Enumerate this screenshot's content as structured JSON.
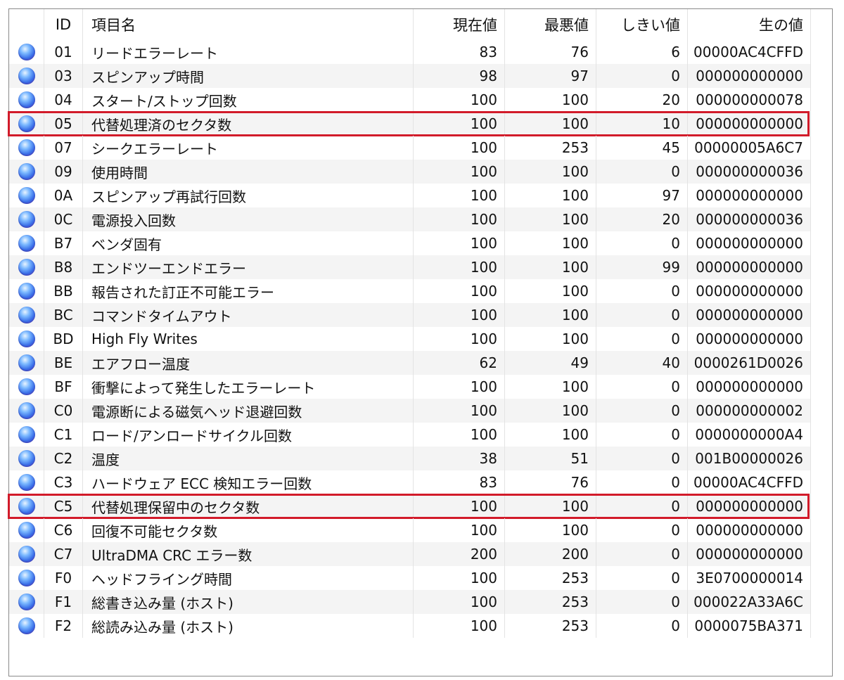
{
  "columns": {
    "id": "ID",
    "name": "項目名",
    "current": "現在値",
    "worst": "最悪値",
    "threshold": "しきい値",
    "raw": "生の値"
  },
  "status_icon": "health-good-icon",
  "highlight_color": "#d21b2a",
  "rows": [
    {
      "id": "01",
      "name": "リードエラーレート",
      "current": "83",
      "worst": "76",
      "threshold": "6",
      "raw": "00000AC4CFFD",
      "highlighted": false
    },
    {
      "id": "03",
      "name": "スピンアップ時間",
      "current": "98",
      "worst": "97",
      "threshold": "0",
      "raw": "000000000000",
      "highlighted": false
    },
    {
      "id": "04",
      "name": "スタート/ストップ回数",
      "current": "100",
      "worst": "100",
      "threshold": "20",
      "raw": "000000000078",
      "highlighted": false
    },
    {
      "id": "05",
      "name": "代替処理済のセクタ数",
      "current": "100",
      "worst": "100",
      "threshold": "10",
      "raw": "000000000000",
      "highlighted": true
    },
    {
      "id": "07",
      "name": "シークエラーレート",
      "current": "100",
      "worst": "253",
      "threshold": "45",
      "raw": "00000005A6C7",
      "highlighted": false
    },
    {
      "id": "09",
      "name": "使用時間",
      "current": "100",
      "worst": "100",
      "threshold": "0",
      "raw": "000000000036",
      "highlighted": false
    },
    {
      "id": "0A",
      "name": "スピンアップ再試行回数",
      "current": "100",
      "worst": "100",
      "threshold": "97",
      "raw": "000000000000",
      "highlighted": false
    },
    {
      "id": "0C",
      "name": "電源投入回数",
      "current": "100",
      "worst": "100",
      "threshold": "20",
      "raw": "000000000036",
      "highlighted": false
    },
    {
      "id": "B7",
      "name": "ベンダ固有",
      "current": "100",
      "worst": "100",
      "threshold": "0",
      "raw": "000000000000",
      "highlighted": false
    },
    {
      "id": "B8",
      "name": "エンドツーエンドエラー",
      "current": "100",
      "worst": "100",
      "threshold": "99",
      "raw": "000000000000",
      "highlighted": false
    },
    {
      "id": "BB",
      "name": "報告された訂正不可能エラー",
      "current": "100",
      "worst": "100",
      "threshold": "0",
      "raw": "000000000000",
      "highlighted": false
    },
    {
      "id": "BC",
      "name": "コマンドタイムアウト",
      "current": "100",
      "worst": "100",
      "threshold": "0",
      "raw": "000000000000",
      "highlighted": false
    },
    {
      "id": "BD",
      "name": "High Fly Writes",
      "current": "100",
      "worst": "100",
      "threshold": "0",
      "raw": "000000000000",
      "highlighted": false
    },
    {
      "id": "BE",
      "name": "エアフロー温度",
      "current": "62",
      "worst": "49",
      "threshold": "40",
      "raw": "0000261D0026",
      "highlighted": false
    },
    {
      "id": "BF",
      "name": "衝撃によって発生したエラーレート",
      "current": "100",
      "worst": "100",
      "threshold": "0",
      "raw": "000000000000",
      "highlighted": false
    },
    {
      "id": "C0",
      "name": "電源断による磁気ヘッド退避回数",
      "current": "100",
      "worst": "100",
      "threshold": "0",
      "raw": "000000000002",
      "highlighted": false
    },
    {
      "id": "C1",
      "name": "ロード/アンロードサイクル回数",
      "current": "100",
      "worst": "100",
      "threshold": "0",
      "raw": "0000000000A4",
      "highlighted": false
    },
    {
      "id": "C2",
      "name": "温度",
      "current": "38",
      "worst": "51",
      "threshold": "0",
      "raw": "001B00000026",
      "highlighted": false
    },
    {
      "id": "C3",
      "name": "ハードウェア ECC 検知エラー回数",
      "current": "83",
      "worst": "76",
      "threshold": "0",
      "raw": "00000AC4CFFD",
      "highlighted": false
    },
    {
      "id": "C5",
      "name": "代替処理保留中のセクタ数",
      "current": "100",
      "worst": "100",
      "threshold": "0",
      "raw": "000000000000",
      "highlighted": true
    },
    {
      "id": "C6",
      "name": "回復不可能セクタ数",
      "current": "100",
      "worst": "100",
      "threshold": "0",
      "raw": "000000000000",
      "highlighted": false
    },
    {
      "id": "C7",
      "name": "UltraDMA CRC エラー数",
      "current": "200",
      "worst": "200",
      "threshold": "0",
      "raw": "000000000000",
      "highlighted": false
    },
    {
      "id": "F0",
      "name": "ヘッドフライング時間",
      "current": "100",
      "worst": "253",
      "threshold": "0",
      "raw": "3E0700000014",
      "highlighted": false
    },
    {
      "id": "F1",
      "name": "総書き込み量 (ホスト)",
      "current": "100",
      "worst": "253",
      "threshold": "0",
      "raw": "000022A33A6C",
      "highlighted": false
    },
    {
      "id": "F2",
      "name": "総読み込み量 (ホスト)",
      "current": "100",
      "worst": "253",
      "threshold": "0",
      "raw": "0000075BA371",
      "highlighted": false
    }
  ]
}
